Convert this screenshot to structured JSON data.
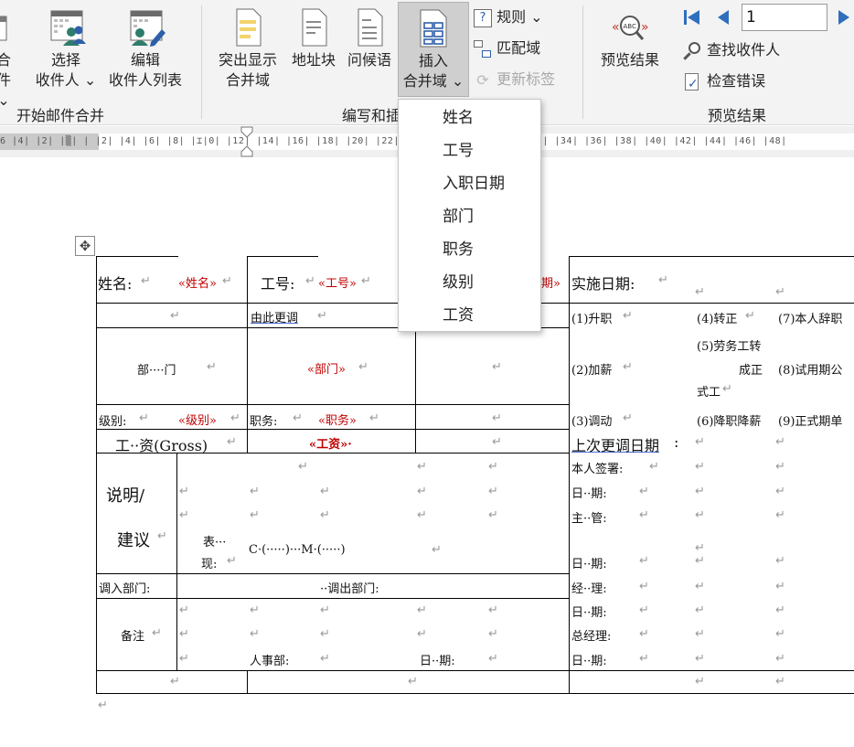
{
  "ribbon": {
    "start_group": {
      "partial_label_top": "合",
      "partial_label_bottom": "件 ⌄",
      "select_recipients": {
        "line1": "选择",
        "line2": "收件人 ⌄"
      },
      "edit_recipients": {
        "line1": "编辑",
        "line2": "收件人列表"
      },
      "group_label": "开始邮件合并"
    },
    "write_group": {
      "highlight_fields": {
        "line1": "突出显示",
        "line2": "合并域"
      },
      "address_block": "地址块",
      "greeting_line": "问候语",
      "insert_field": {
        "line1": "插入",
        "line2": "合并域 ⌄"
      },
      "rules": "规则 ⌄",
      "match_fields": "匹配域",
      "update_labels": "更新标签",
      "group_label": "编写和插"
    },
    "preview_group": {
      "preview_results": "预览结果",
      "record_number": "1",
      "find_recipient": "查找收件人",
      "check_errors": "检查错误",
      "group_label": "预览结果"
    }
  },
  "ruler": {
    "text": "6 |4| |2| |▒| |  |2| |4| |6| |8| |⌶|0| |12| |14| |16| |18| |20| |22| |24| |26| |28| |30| |32| |34| |36| |38| |40| |42| |44| |46| |48|"
  },
  "dropdown": {
    "items": [
      "姓名",
      "工号",
      "入职日期",
      "部门",
      "职务",
      "级别",
      "工资"
    ]
  },
  "document": {
    "mark": "↵",
    "name_label": "姓名:",
    "name_field": "«姓名»",
    "id_label": "工号:",
    "id_field": "«工号»",
    "date_field_partial": "期»",
    "effective_date": "实施日期:",
    "reason": "由此更调",
    "dept_label": "部····门",
    "dept_field": "«部门»",
    "level_label": "级别:",
    "level_field": "«级别»",
    "title_label": "职务:",
    "title_field": "«职务»",
    "salary_label": "工··资(Gross)",
    "salary_field": "«工资»·",
    "opt1": "(1)升职",
    "opt2": "(2)加薪",
    "opt3": "(3)调动",
    "opt4": "(4)转正",
    "opt5a": "(5)劳务工转",
    "opt5b": "成正",
    "opt5c": "式工",
    "opt6": "(6)降职降薪",
    "opt7": "(7)本人辞职",
    "opt8": "(8)试用期公",
    "opt9": "(9)正式期单",
    "last_change": "上次更调日期",
    "remark_label_1": "说明/",
    "remark_label_2": "建议",
    "perf_1": "表···",
    "perf_2": "现:",
    "perf_cm": "C·(·····)···M·(·····)",
    "sign_self": "本人签署:",
    "date_label": "日··期:",
    "supervisor": "主··管:",
    "in_dept": "调入部门:",
    "out_dept": "··调出部门:",
    "manager": "经··理:",
    "general_manager": "总经理:",
    "notes": "备注",
    "hr_dept": "人事部:"
  }
}
